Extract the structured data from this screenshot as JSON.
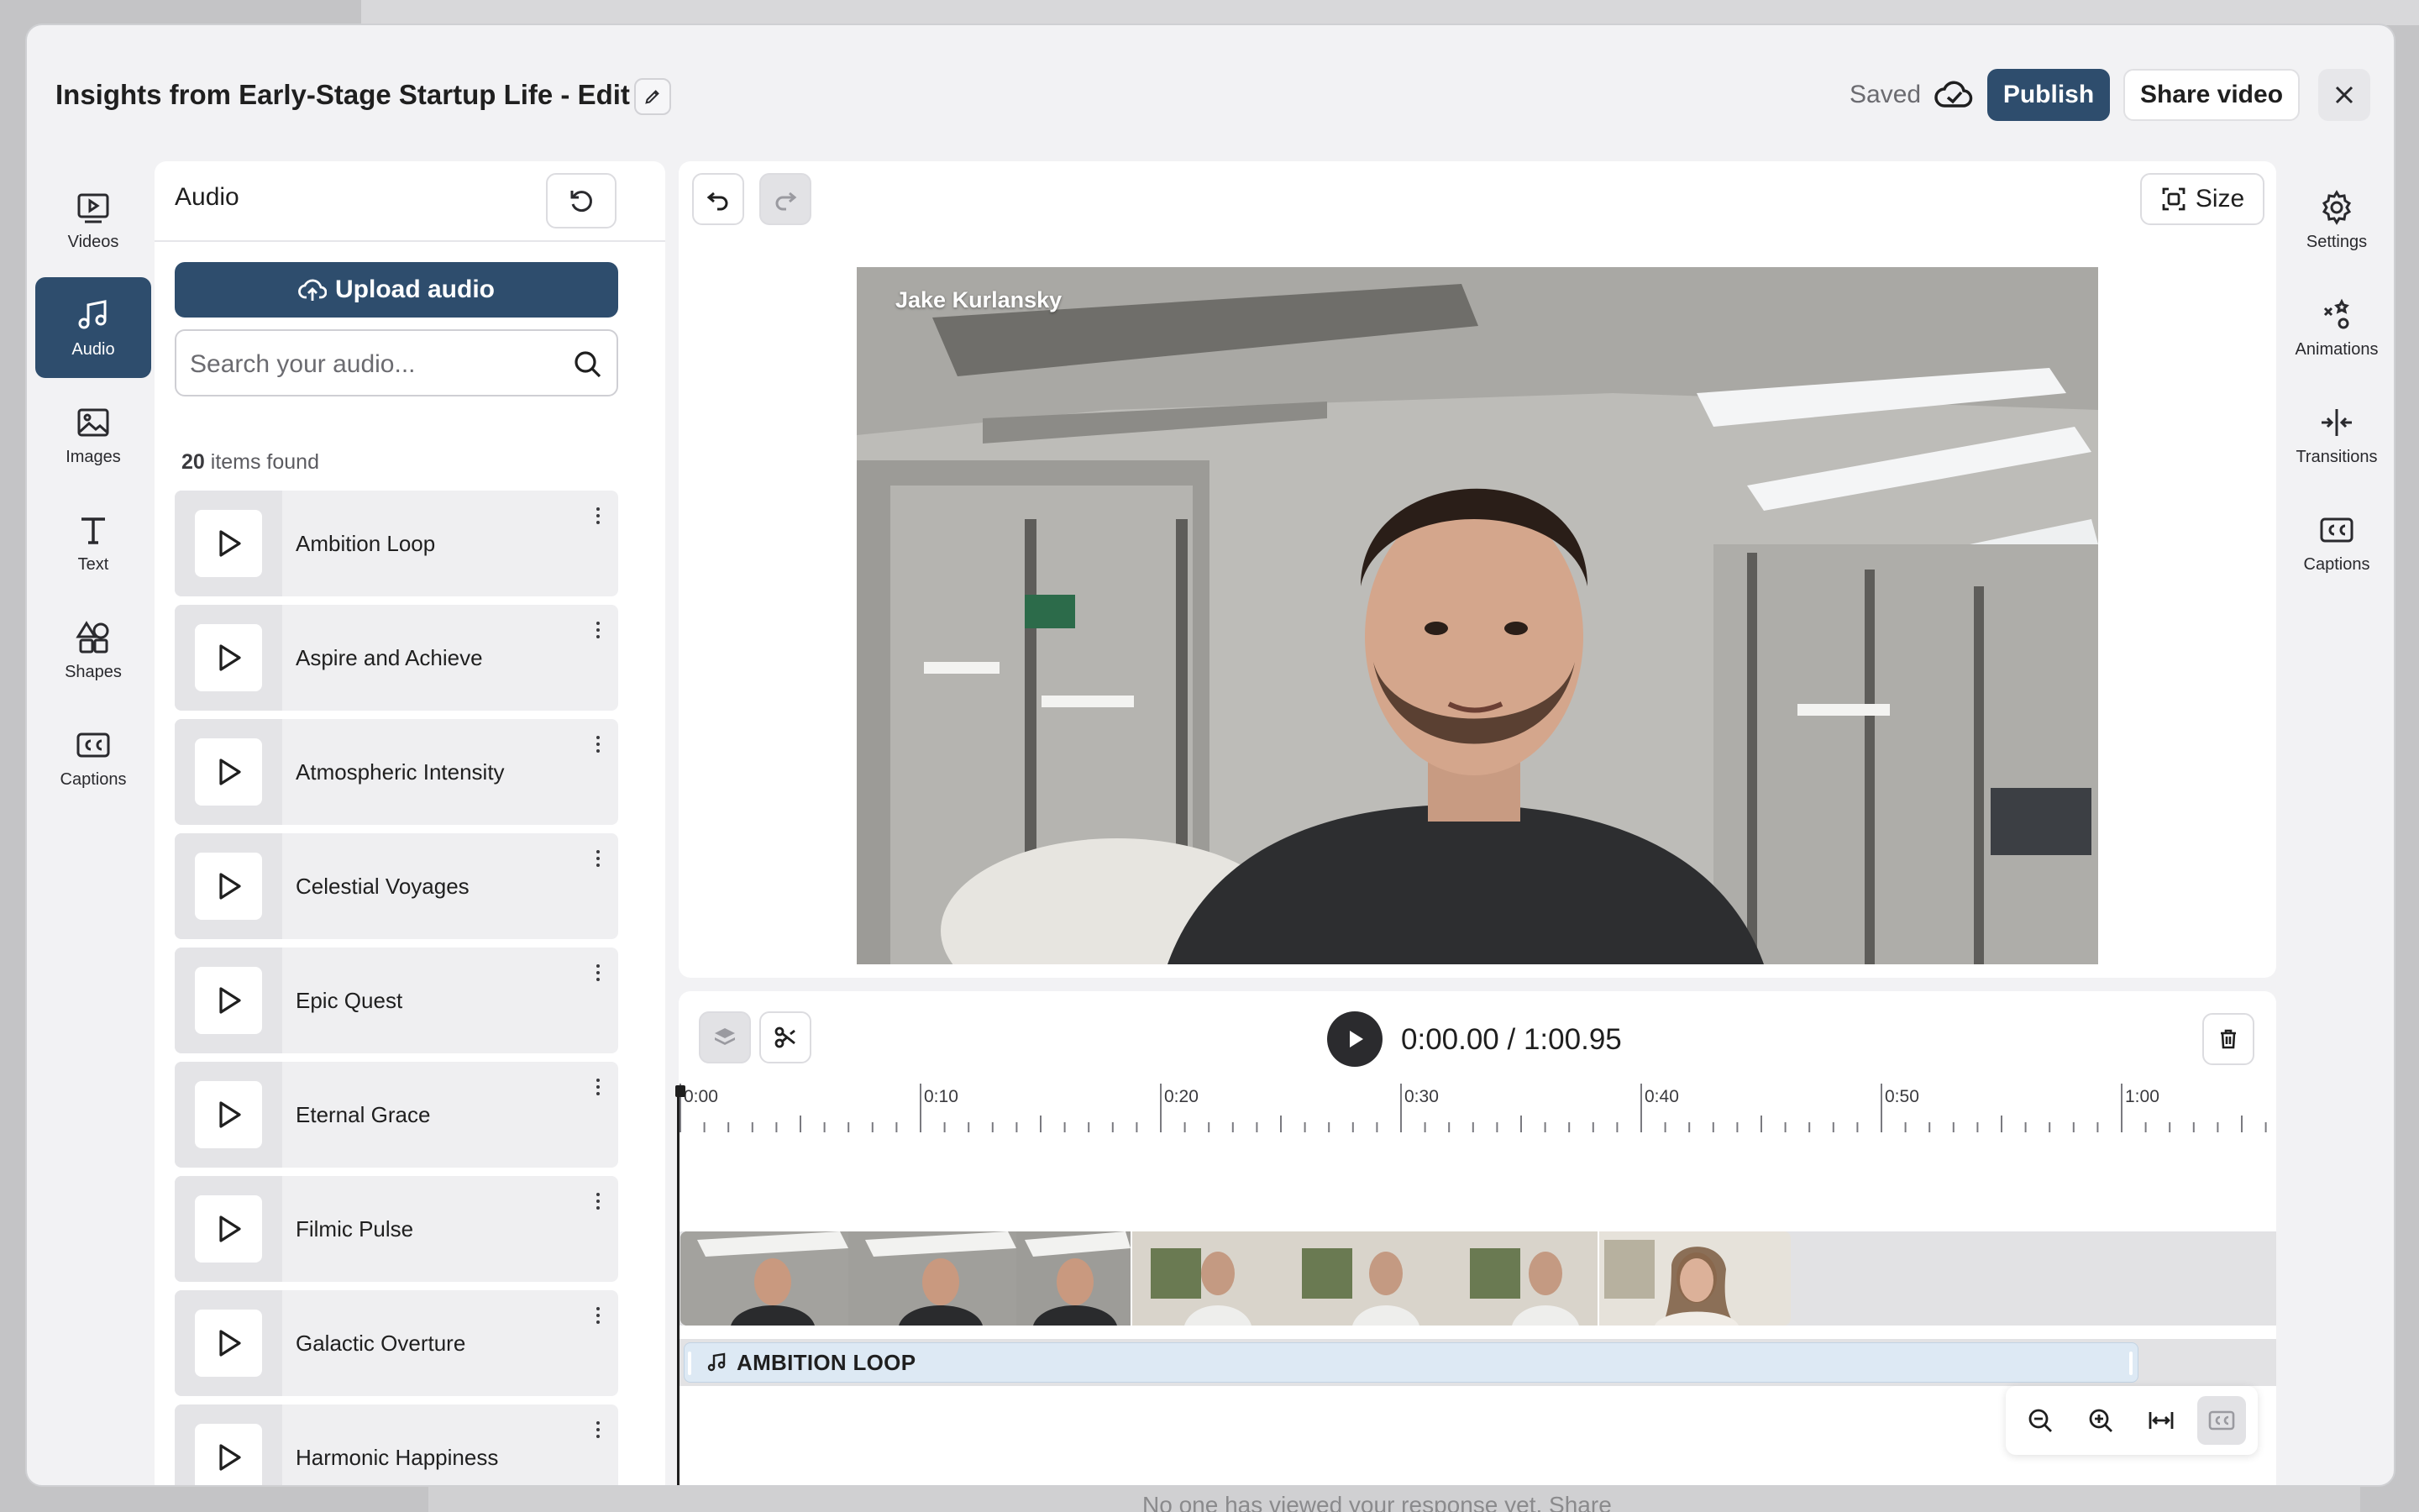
{
  "backdrop": {
    "bottom_text": "No one has viewed your response yet. Share"
  },
  "header": {
    "title": "Insights from Early-Stage Startup Life - Edit",
    "saved_label": "Saved",
    "publish_label": "Publish",
    "share_label": "Share video"
  },
  "left_rail": {
    "items": [
      {
        "label": "Videos",
        "icon": "video-play-icon",
        "active": false
      },
      {
        "label": "Audio",
        "icon": "music-note-icon",
        "active": true
      },
      {
        "label": "Images",
        "icon": "image-icon",
        "active": false
      },
      {
        "label": "Text",
        "icon": "text-icon",
        "active": false
      },
      {
        "label": "Shapes",
        "icon": "shapes-icon",
        "active": false
      },
      {
        "label": "Captions",
        "icon": "captions-icon",
        "active": false
      }
    ]
  },
  "audio_panel": {
    "title": "Audio",
    "upload_label": "Upload audio",
    "search_placeholder": "Search your audio...",
    "found_count": "20",
    "found_suffix": " items found",
    "tracks": [
      "Ambition Loop",
      "Aspire and Achieve",
      "Atmospheric Intensity",
      "Celestial Voyages",
      "Epic Quest",
      "Eternal Grace",
      "Filmic Pulse",
      "Galactic Overture",
      "Harmonic Happiness"
    ]
  },
  "preview": {
    "size_label": "Size",
    "speaker_name": "Jake Kurlansky"
  },
  "timeline": {
    "current_time": "0:00.00",
    "separator": " / ",
    "total_time": "1:00.95",
    "ticks": [
      "0:00",
      "0:10",
      "0:20",
      "0:30",
      "0:40",
      "0:50",
      "1:00"
    ],
    "audio_track_label": "AMBITION LOOP"
  },
  "right_rail": {
    "items": [
      {
        "label": "Settings",
        "icon": "gear-icon"
      },
      {
        "label": "Animations",
        "icon": "animations-icon"
      },
      {
        "label": "Transitions",
        "icon": "transitions-icon"
      },
      {
        "label": "Captions",
        "icon": "captions-icon"
      }
    ]
  },
  "colors": {
    "accent": "#2e4d6d",
    "panel_bg": "#ffffff",
    "modal_bg": "#f2f2f4",
    "audio_clip": "#dde9f4"
  }
}
